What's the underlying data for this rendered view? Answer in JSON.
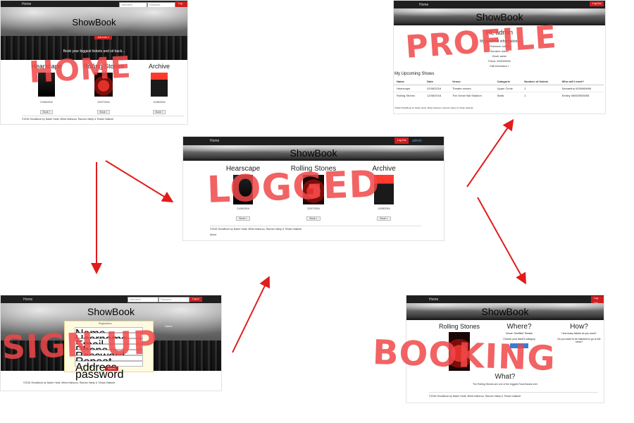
{
  "colors": {
    "overlay": "#f0484a",
    "arrow": "#e21b1b",
    "nav": "#1f1f1f",
    "button": "#cc1f1f"
  },
  "nav": {
    "home": "Home",
    "username_placeholder": "Username",
    "password_placeholder": "Password",
    "login": "Log in",
    "logout": "Log Out",
    "admin": "admin"
  },
  "brand": "ShowBook",
  "shows": [
    {
      "name": "Hearscape",
      "date": "21/06/2016",
      "button": "Book »"
    },
    {
      "name": "Rolling Stones",
      "date": "22/07/2016",
      "button": "Book »"
    },
    {
      "name": "Archive",
      "date": "11/08/2016",
      "button": "Book »"
    }
  ],
  "home": {
    "overlay": "HOME",
    "hero_button": "Join now »",
    "tagline": "Book your biggest tickets and sit back..."
  },
  "logged": {
    "overlay": "LOGGED",
    "about": "About"
  },
  "signup": {
    "overlay": "SIGN UP",
    "form_title": "Registration",
    "fields": [
      "Name",
      "Username",
      "Email",
      "Phone",
      "Password",
      "Repeat password",
      "Address"
    ],
    "submit": "Submit",
    "side_text": "Users"
  },
  "profile": {
    "overlay": "PROFILE",
    "greeting": "Hi, admin",
    "info_title": "My personal informations",
    "info_lines": [
      "Firstname: Admin",
      "Surname: Admin",
      "Email: admin",
      "Phone: 0000000000"
    ],
    "info_link": "Edit information »",
    "upcoming_title": "My Upcoming Shows",
    "columns": [
      "Name",
      "Date",
      "Venue",
      "Categorie",
      "Number of tickets",
      "Who will I meet?"
    ],
    "rows": [
      [
        "Hearscape",
        "02/06/2016",
        "Theatre maxim",
        "Upper Circle",
        "2",
        "Samantha 0436969696"
      ],
      [
        "Rolling Stones",
        "12/08/2016",
        "The Great Hall Stadium",
        "Stalls",
        "1",
        "Emiley 0605/0505055"
      ]
    ]
  },
  "booking": {
    "overlay": "BOOKING",
    "show": "Rolling Stones",
    "where_title": "Where?",
    "venue_line": "Venue: Sheffield Theatre",
    "category_line": "Choose your ticket's category",
    "how_title": "How?",
    "how_line": "How many tickets do you want?",
    "how_line2": "Do you want to be matched to go to the show?",
    "what_title": "What?",
    "what_line": "The Rolling Stones are one of the biggest Rock Bands ever"
  },
  "footer": "©2016 ShowBook by Nader Hanit, Mihai Iridescuu, Razvan Vainly & Tristan Valande"
}
